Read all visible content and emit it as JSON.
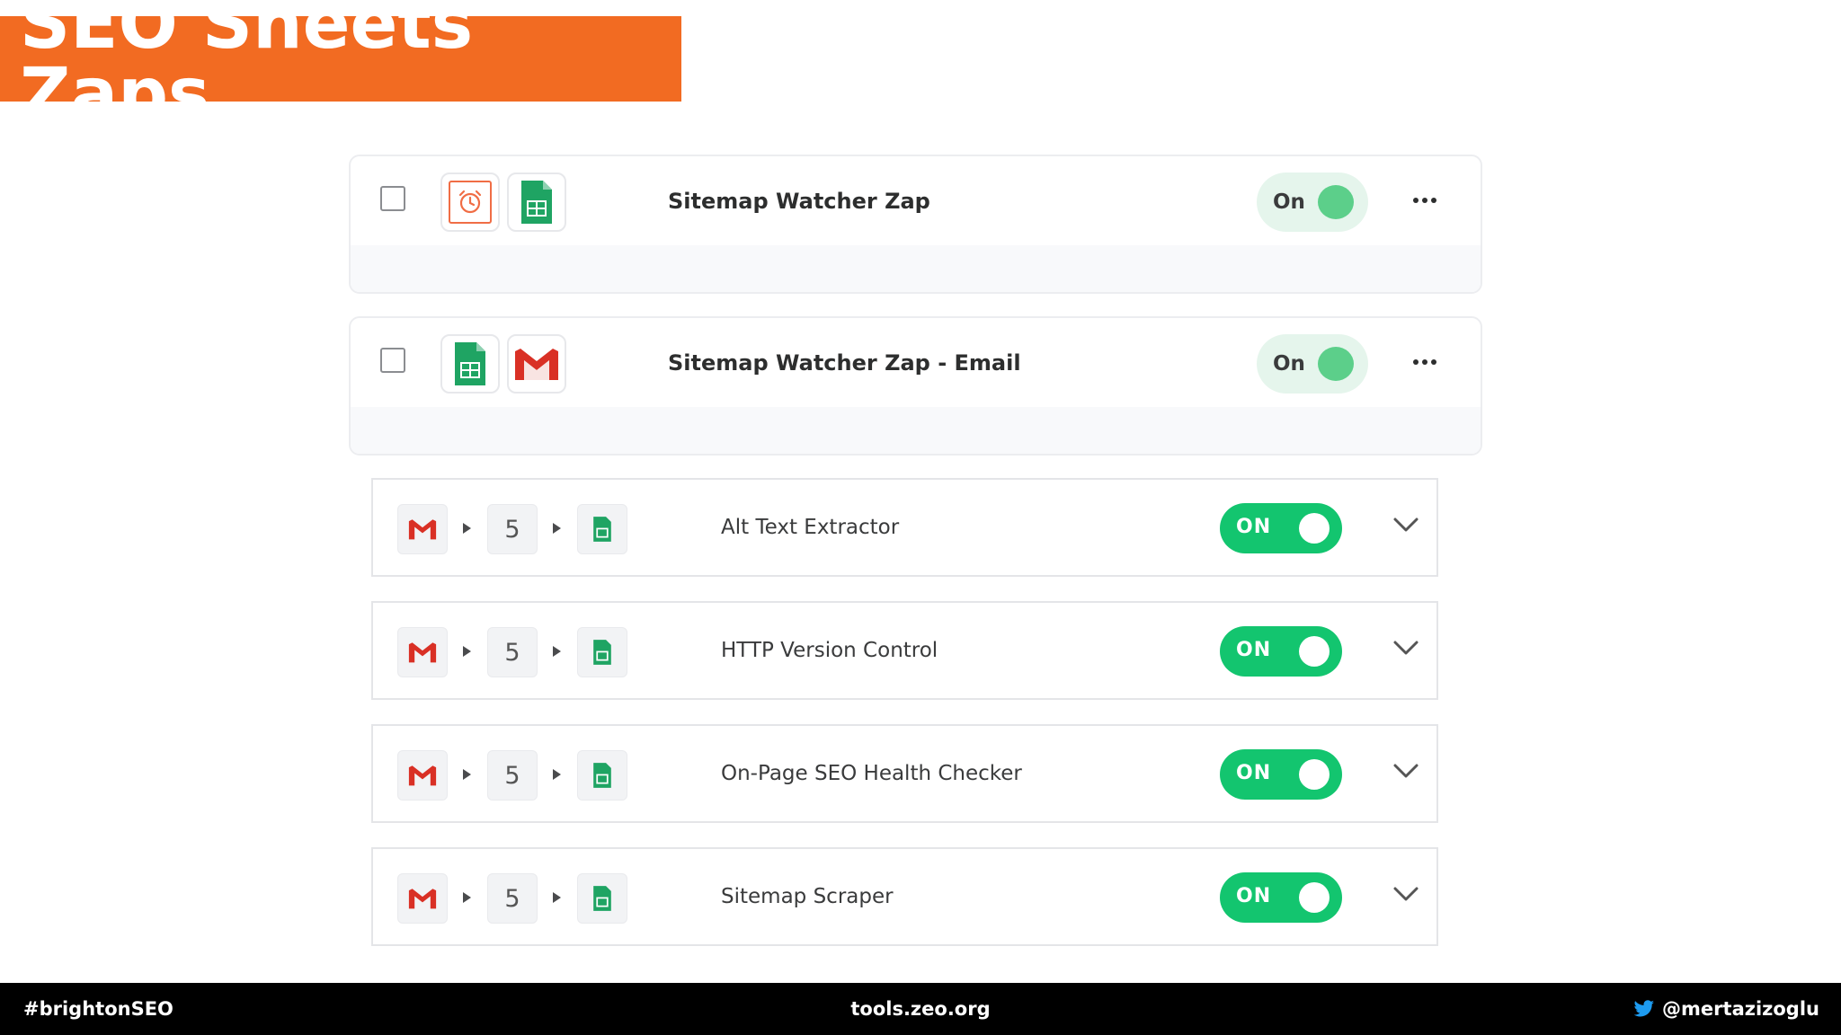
{
  "title": "SEO Sheets Zaps",
  "top_zaps": [
    {
      "name": "Sitemap Watcher Zap",
      "status": "On",
      "apps": [
        "alarm-clock-icon",
        "google-sheets-icon"
      ]
    },
    {
      "name": "Sitemap Watcher Zap - Email",
      "status": "On",
      "apps": [
        "google-sheets-icon",
        "gmail-icon"
      ]
    }
  ],
  "zaps": [
    {
      "name": "Alt Text Extractor",
      "steps": "5",
      "status": "ON"
    },
    {
      "name": "HTTP Version Control",
      "steps": "5",
      "status": "ON"
    },
    {
      "name": "On-Page SEO Health Checker",
      "steps": "5",
      "status": "ON"
    },
    {
      "name": "Sitemap Scraper",
      "steps": "5",
      "status": "ON"
    }
  ],
  "footer": {
    "left": "#brightonSEO",
    "center": "tools.zeo.org",
    "right": "@mertazizoglu"
  },
  "colors": {
    "banner": "#f26b22",
    "toggle_on": "#13c56f",
    "pill_bg": "#e5f5ec",
    "pill_knob": "#5ccf8a",
    "sheets_green": "#1fa463",
    "gmail_red": "#d93025"
  }
}
